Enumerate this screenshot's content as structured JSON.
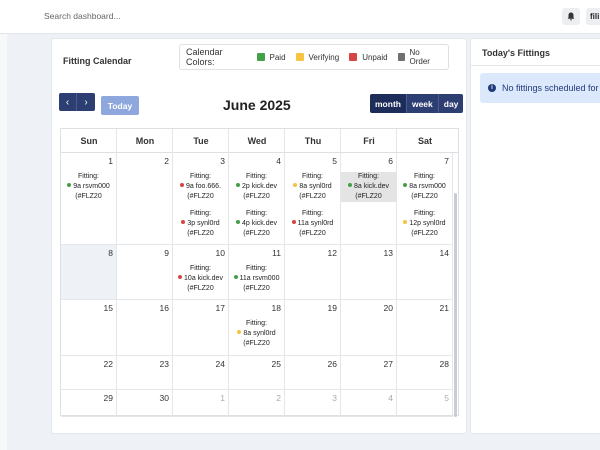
{
  "header": {
    "search_placeholder": "Search dashboard...",
    "user_label": "fili"
  },
  "calendar": {
    "title": "Fitting Calendar",
    "legend_label": "Calendar Colors:",
    "legend": [
      {
        "label": "Paid",
        "color": "#43a047"
      },
      {
        "label": "Verifying",
        "color": "#f6c342"
      },
      {
        "label": "Unpaid",
        "color": "#d64545"
      },
      {
        "label": "No Order",
        "color": "#707070"
      }
    ],
    "nav": {
      "prev": "‹",
      "next": "›",
      "today": "Today"
    },
    "month_title": "June 2025",
    "views": [
      "month",
      "week",
      "day"
    ],
    "active_view": "month",
    "weekdays": [
      "Sun",
      "Mon",
      "Tue",
      "Wed",
      "Thu",
      "Fri",
      "Sat"
    ],
    "weeks": [
      [
        {
          "day": "1",
          "events": [
            {
              "title": "Fitting:",
              "name": "9a rsvm000",
              "ref": "(#FLZ20",
              "status": "paid"
            }
          ]
        },
        {
          "day": "2",
          "events": []
        },
        {
          "day": "3",
          "events": [
            {
              "title": "Fitting:",
              "name": "9a foo.666.",
              "ref": "(#FLZ20",
              "status": "unpaid"
            },
            {
              "title": "Fitting:",
              "name": "3p synl0rd",
              "ref": "(#FLZ20",
              "status": "unpaid"
            }
          ]
        },
        {
          "day": "4",
          "events": [
            {
              "title": "Fitting:",
              "name": "2p kick.dev",
              "ref": "(#FLZ20",
              "status": "paid"
            },
            {
              "title": "Fitting:",
              "name": "4p kick.dev",
              "ref": "(#FLZ20",
              "status": "paid"
            }
          ]
        },
        {
          "day": "5",
          "events": [
            {
              "title": "Fitting:",
              "name": "8a synl0rd",
              "ref": "(#FLZ20",
              "status": "verifying"
            },
            {
              "title": "Fitting:",
              "name": "11a synl0rd",
              "ref": "(#FLZ20",
              "status": "unpaid"
            }
          ]
        },
        {
          "day": "6",
          "events": [
            {
              "title": "Fitting:",
              "name": "8a kick.dev",
              "ref": "(#FLZ20",
              "status": "paid"
            }
          ]
        },
        {
          "day": "7",
          "events": [
            {
              "title": "Fitting:",
              "name": "8a rsvm000",
              "ref": "(#FLZ20",
              "status": "paid"
            },
            {
              "title": "Fitting:",
              "name": "12p synl0rd",
              "ref": "(#FLZ20",
              "status": "verifying"
            }
          ]
        }
      ],
      [
        {
          "day": "8",
          "events": []
        },
        {
          "day": "9",
          "events": []
        },
        {
          "day": "10",
          "events": [
            {
              "title": "Fitting:",
              "name": "10a kick.dev",
              "ref": "(#FLZ20",
              "status": "unpaid"
            }
          ]
        },
        {
          "day": "11",
          "events": [
            {
              "title": "Fitting:",
              "name": "11a rsvm000",
              "ref": "(#FLZ20",
              "status": "paid"
            }
          ]
        },
        {
          "day": "12",
          "events": []
        },
        {
          "day": "13",
          "events": []
        },
        {
          "day": "14",
          "events": []
        }
      ],
      [
        {
          "day": "15",
          "events": []
        },
        {
          "day": "16",
          "events": []
        },
        {
          "day": "17",
          "events": []
        },
        {
          "day": "18",
          "events": [
            {
              "title": "Fitting:",
              "name": "8a synl0rd",
              "ref": "(#FLZ20",
              "status": "verifying"
            }
          ]
        },
        {
          "day": "19",
          "events": []
        },
        {
          "day": "20",
          "events": []
        },
        {
          "day": "21",
          "events": []
        }
      ],
      [
        {
          "day": "22",
          "events": []
        },
        {
          "day": "23",
          "events": []
        },
        {
          "day": "24",
          "events": []
        },
        {
          "day": "25",
          "events": []
        },
        {
          "day": "26",
          "events": []
        },
        {
          "day": "27",
          "events": []
        },
        {
          "day": "28",
          "events": []
        }
      ],
      [
        {
          "day": "29",
          "events": []
        },
        {
          "day": "30",
          "events": []
        },
        {
          "day": "1",
          "events": [],
          "other_month": true
        },
        {
          "day": "2",
          "events": [],
          "other_month": true
        },
        {
          "day": "3",
          "events": [],
          "other_month": true
        },
        {
          "day": "4",
          "events": [],
          "other_month": true
        },
        {
          "day": "5",
          "events": [],
          "other_month": true
        }
      ]
    ]
  },
  "sidebar": {
    "title": "Today's Fittings",
    "empty_message": "No fittings scheduled for today"
  }
}
